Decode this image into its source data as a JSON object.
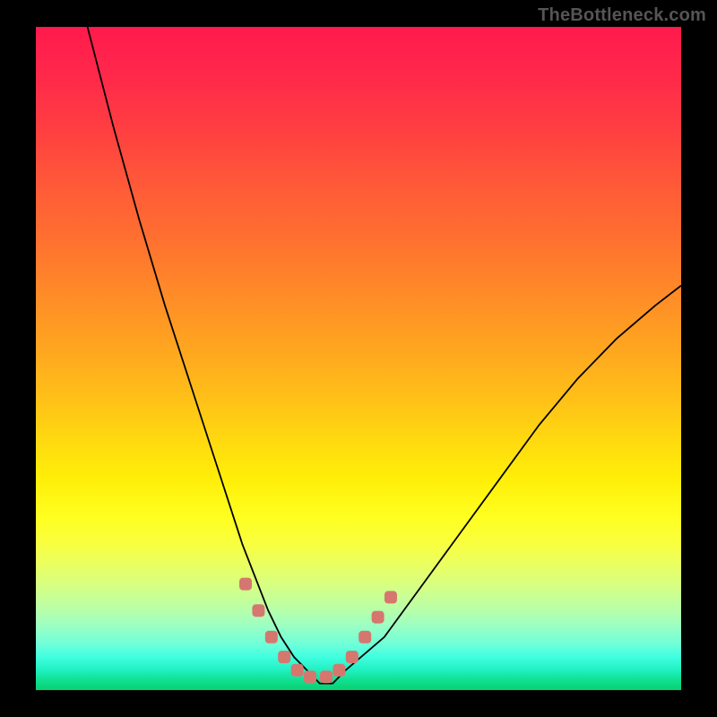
{
  "watermark": "TheBottleneck.com",
  "colors": {
    "frame_bg": "#000000",
    "marker": "#d6776f",
    "curve": "#000000",
    "gradient_top": "#ff1a4d",
    "gradient_bottom": "#08d070"
  },
  "chart_data": {
    "type": "line",
    "title": "",
    "xlabel": "",
    "ylabel": "",
    "xlim": [
      0,
      100
    ],
    "ylim": [
      0,
      100
    ],
    "grid": false,
    "series": [
      {
        "name": "bottleneck-curve",
        "x": [
          8,
          12,
          16,
          20,
          24,
          26,
          28,
          30,
          32,
          34,
          36,
          38,
          40,
          42,
          44,
          46,
          48,
          54,
          60,
          66,
          72,
          78,
          84,
          90,
          96,
          100
        ],
        "values": [
          100,
          85,
          71,
          58,
          46,
          40,
          34,
          28,
          22,
          17,
          12,
          8,
          5,
          3,
          1,
          1,
          3,
          8,
          16,
          24,
          32,
          40,
          47,
          53,
          58,
          61
        ]
      }
    ],
    "markers": {
      "name": "highlight-points",
      "points": [
        {
          "x": 32.5,
          "y": 16
        },
        {
          "x": 34.5,
          "y": 12
        },
        {
          "x": 36.5,
          "y": 8
        },
        {
          "x": 38.5,
          "y": 5
        },
        {
          "x": 40.5,
          "y": 3
        },
        {
          "x": 42.5,
          "y": 2
        },
        {
          "x": 45.0,
          "y": 2
        },
        {
          "x": 47.0,
          "y": 3
        },
        {
          "x": 49.0,
          "y": 5
        },
        {
          "x": 51.0,
          "y": 8
        },
        {
          "x": 53.0,
          "y": 11
        },
        {
          "x": 55.0,
          "y": 14
        }
      ]
    }
  }
}
